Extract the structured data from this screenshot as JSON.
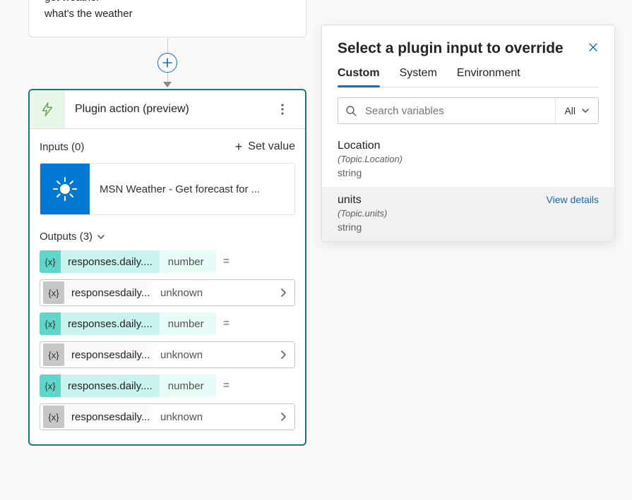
{
  "trigger": {
    "lines": [
      "get weather",
      "what's the weather"
    ]
  },
  "plugin_card": {
    "title": "Plugin action (preview)",
    "inputs_label": "Inputs (0)",
    "set_value_label": "Set value",
    "item_label": "MSN Weather - Get forecast for ...",
    "outputs_label": "Outputs (3)",
    "outputs": [
      {
        "var_name": "responses.daily....",
        "var_type": "number",
        "exp_name": "responsesdaily...",
        "exp_type": "unknown"
      },
      {
        "var_name": "responses.daily....",
        "var_type": "number",
        "exp_name": "responsesdaily...",
        "exp_type": "unknown"
      },
      {
        "var_name": "responses.daily....",
        "var_type": "number",
        "exp_name": "responsesdaily...",
        "exp_type": "unknown"
      }
    ]
  },
  "panel": {
    "title": "Select a plugin input to override",
    "tabs": {
      "custom": "Custom",
      "system": "System",
      "environment": "Environment"
    },
    "search_placeholder": "Search variables",
    "all_label": "All",
    "results": [
      {
        "name": "Location",
        "path": "(Topic.Location)",
        "type": "string",
        "hover": false
      },
      {
        "name": "units",
        "path": "(Topic.units)",
        "type": "string",
        "hover": true,
        "link": "View details"
      }
    ]
  }
}
